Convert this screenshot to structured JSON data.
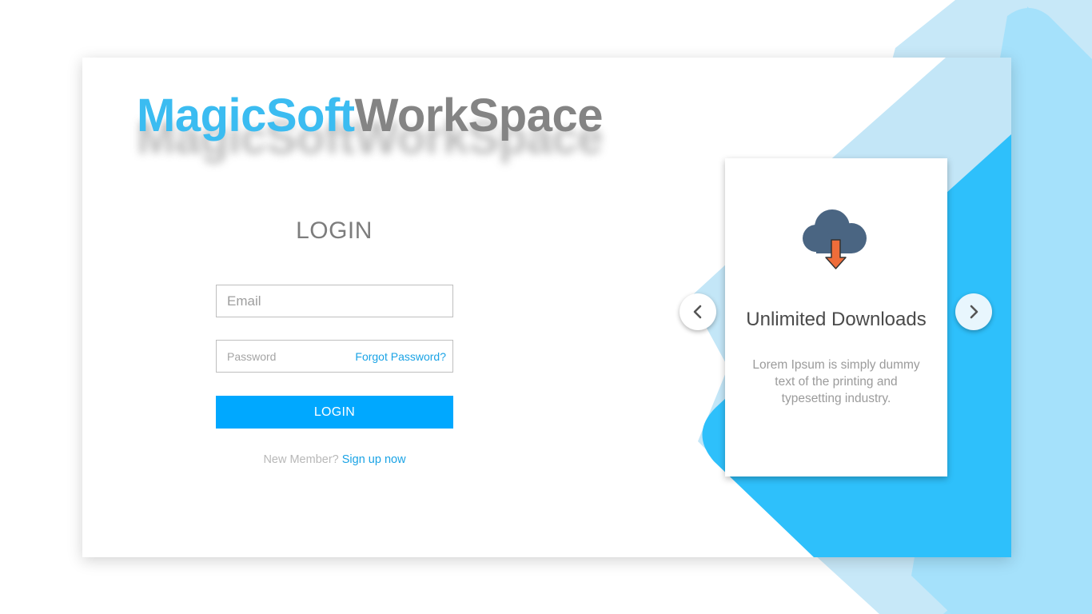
{
  "brand": {
    "part1": "MagicSoft",
    "part2": "WorkSpace"
  },
  "login": {
    "title": "LOGIN",
    "email_placeholder": "Email",
    "password_placeholder": "Password",
    "forgot_label": "Forgot Password?",
    "button_label": "LOGIN",
    "new_member_text": "New Member?",
    "signup_label": "Sign up now"
  },
  "feature": {
    "icon": "cloud-download-icon",
    "title": "Unlimited Downloads",
    "description": "Lorem Ipsum is simply dummy text of the printing and typesetting industry."
  },
  "carousel": {
    "prev_icon": "chevron-left-icon",
    "next_icon": "chevron-right-icon"
  },
  "colors": {
    "brand_blue": "#3bbcf1",
    "brand_gray": "#848484",
    "accent": "#00a8ff",
    "link": "#1aa3e5",
    "panel_blue": "#2ec0fb",
    "panel_light": "#bfe5f7",
    "icon_cloud": "#4a6582",
    "icon_arrow": "#ef6d3a"
  }
}
